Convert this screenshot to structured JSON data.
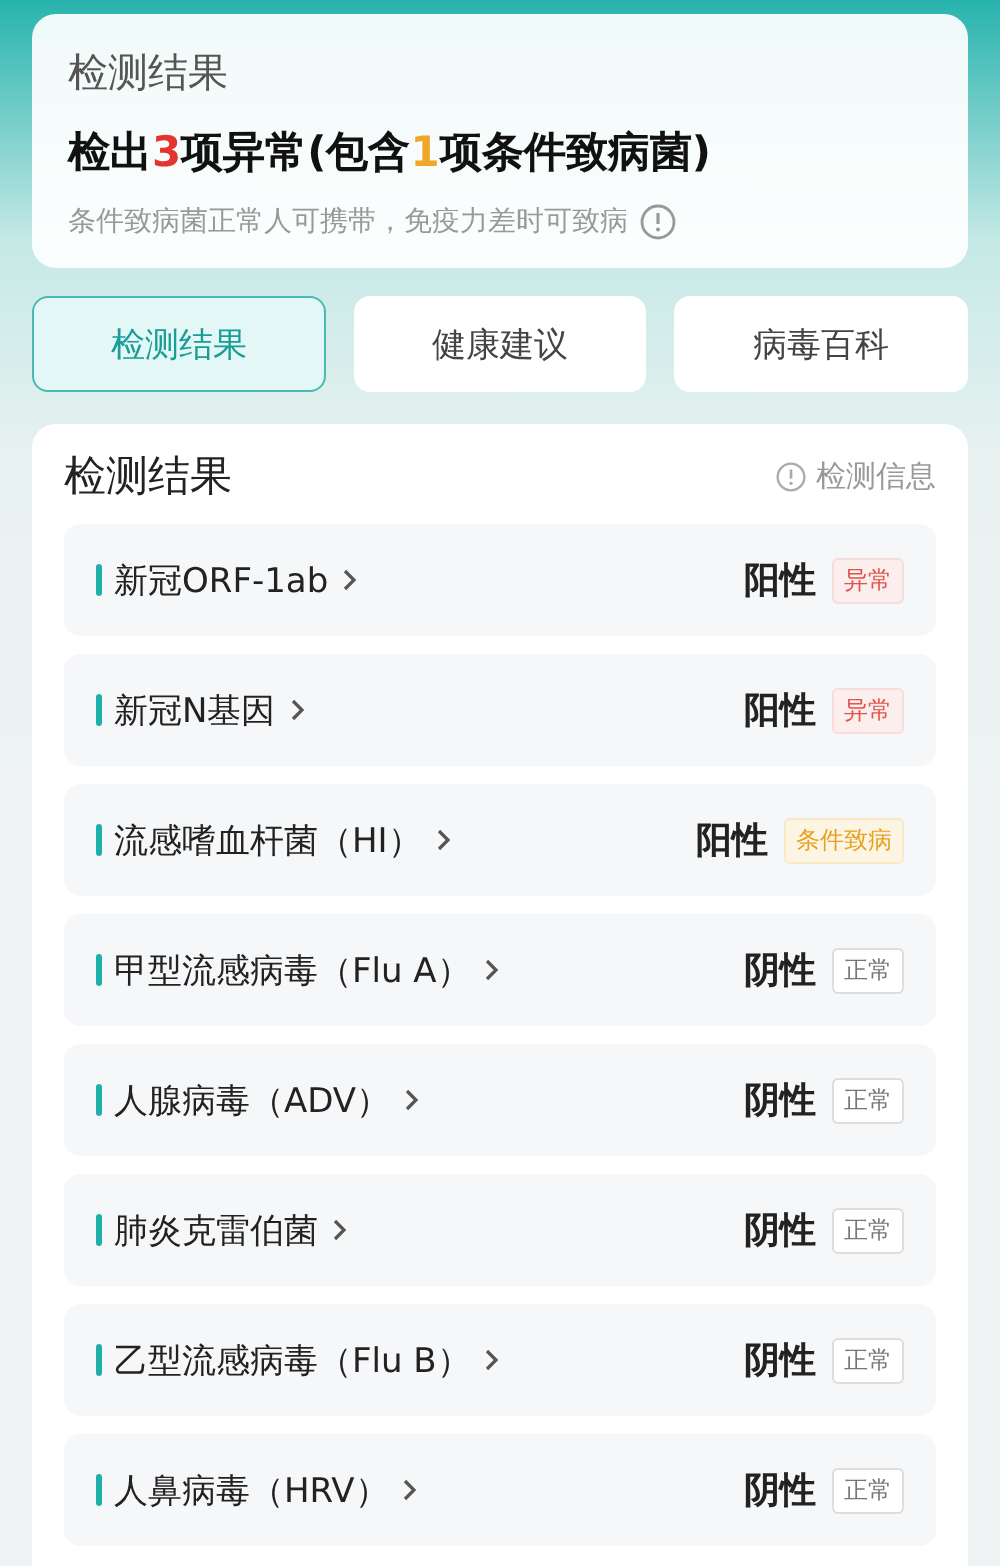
{
  "summary": {
    "title": "检测结果",
    "headline": [
      {
        "text": "检出",
        "kind": "plain"
      },
      {
        "text": "3",
        "kind": "abnormal"
      },
      {
        "text": "项异常(包含",
        "kind": "plain"
      },
      {
        "text": "1",
        "kind": "conditional"
      },
      {
        "text": "项条件致病菌)",
        "kind": "plain"
      }
    ],
    "note": "条件致病菌正常人可携带，免疫力差时可致病"
  },
  "tabs": [
    {
      "label": "检测结果",
      "selected": true
    },
    {
      "label": "健康建议",
      "selected": false
    },
    {
      "label": "病毒百科",
      "selected": false
    }
  ],
  "results": {
    "title": "检测结果",
    "info_link": "检测信息",
    "rows": [
      {
        "name": "新冠ORF-1ab",
        "result": "阳性",
        "tag": "异常",
        "kind": "abnormal"
      },
      {
        "name": "新冠N基因",
        "result": "阳性",
        "tag": "异常",
        "kind": "abnormal"
      },
      {
        "name": "流感嗜血杆菌（HI）",
        "result": "阳性",
        "tag": "条件致病",
        "kind": "conditional"
      },
      {
        "name": "甲型流感病毒（Flu A）",
        "result": "阴性",
        "tag": "正常",
        "kind": "normal"
      },
      {
        "name": "人腺病毒（ADV）",
        "result": "阴性",
        "tag": "正常",
        "kind": "normal"
      },
      {
        "name": "肺炎克雷伯菌",
        "result": "阴性",
        "tag": "正常",
        "kind": "normal"
      },
      {
        "name": "乙型流感病毒（Flu B）",
        "result": "阴性",
        "tag": "正常",
        "kind": "normal"
      },
      {
        "name": "人鼻病毒（HRV）",
        "result": "阴性",
        "tag": "正常",
        "kind": "normal"
      }
    ]
  }
}
